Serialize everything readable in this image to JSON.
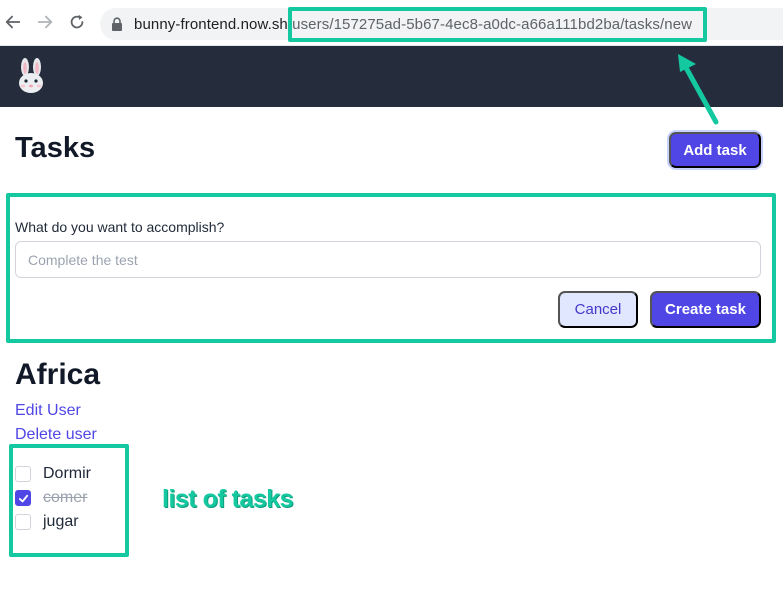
{
  "browser": {
    "url_host": "bunny-frontend.now.sh/",
    "url_path": "users/157275ad-5b67-4ec8-a0dc-a66a111bd2ba/tasks/new"
  },
  "header": {
    "logo_icon": "bunny-icon"
  },
  "page": {
    "title": "Tasks",
    "add_task_label": "Add task"
  },
  "task_form": {
    "label": "What do you want to accomplish?",
    "input_value": "",
    "input_placeholder": "Complete the test",
    "cancel_label": "Cancel",
    "create_label": "Create task"
  },
  "user": {
    "name": "Africa",
    "edit_label": "Edit User",
    "delete_label": "Delete user"
  },
  "tasks": [
    {
      "label": "Dormir",
      "done": false
    },
    {
      "label": "comer",
      "done": true
    },
    {
      "label": "jugar",
      "done": false
    }
  ],
  "annotations": {
    "list_caption": "list of tasks",
    "color": "#14c8a0"
  },
  "colors": {
    "header_bg": "#252d3d",
    "accent": "#4f46e5",
    "cancel_bg": "#e0e7ff"
  }
}
